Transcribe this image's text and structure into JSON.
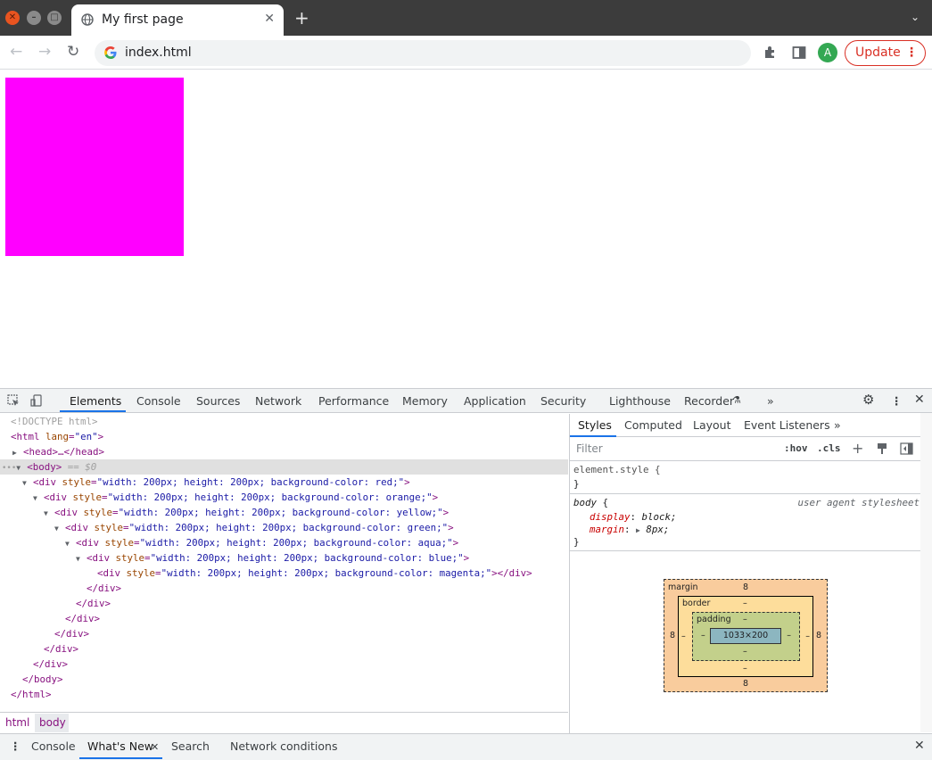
{
  "browser": {
    "tab_title": "My first page",
    "url": "index.html",
    "update_label": "Update",
    "profile_initial": "A",
    "window_controls": [
      "close",
      "minimize",
      "maximize"
    ]
  },
  "page": {
    "box_color": "#ff00ff"
  },
  "devtools": {
    "tabs": [
      "Elements",
      "Console",
      "Sources",
      "Network",
      "Performance",
      "Memory",
      "Application",
      "Security",
      "Lighthouse",
      "Recorder"
    ],
    "active_tab": "Elements",
    "elements": {
      "doctype": "<!DOCTYPE html>",
      "html_open": "<html",
      "html_attr_name": "lang",
      "html_attr_value": "\"en\"",
      "head": "<head>…</head>",
      "body_open": "<body>",
      "body_marker": "== $0",
      "div_open": "<div",
      "style_attr": "style",
      "div_styles": [
        "\"width: 200px; height: 200px; background-color: red;\"",
        "\"width: 200px; height: 200px; background-color: orange;\"",
        "\"width: 200px; height: 200px; background-color: yellow;\"",
        "\"width: 200px; height: 200px; background-color: green;\"",
        "\"width: 200px; height: 200px; background-color: aqua;\"",
        "\"width: 200px; height: 200px; background-color: blue;\"",
        "\"width: 200px; height: 200px; background-color: magenta;\""
      ],
      "div_close": "</div>",
      "body_close": "</body>",
      "html_close": "</html>"
    },
    "breadcrumbs": [
      "html",
      "body"
    ],
    "styles": {
      "tabs": [
        "Styles",
        "Computed",
        "Layout",
        "Event Listeners"
      ],
      "filter_placeholder": "Filter",
      "hov": ":hov",
      "cls": ".cls",
      "element_style": "element.style",
      "rule_selector": "body",
      "rule_source": "user agent stylesheet",
      "props": [
        {
          "name": "display",
          "value": "block;"
        },
        {
          "name": "margin",
          "value": "8px;"
        }
      ]
    },
    "box_model": {
      "margin_label": "margin",
      "border_label": "border",
      "padding_label": "padding",
      "margin": {
        "top": "8",
        "right": "8",
        "bottom": "8",
        "left": "8"
      },
      "border": {
        "top": "–",
        "right": "–",
        "bottom": "–",
        "left": "–"
      },
      "padding": {
        "top": "–",
        "right": "–",
        "bottom": "–",
        "left": "–"
      },
      "content": "1033×200"
    },
    "drawer_tabs": [
      "Console",
      "What's New",
      "Search",
      "Network conditions"
    ],
    "active_drawer_tab": "What's New"
  }
}
